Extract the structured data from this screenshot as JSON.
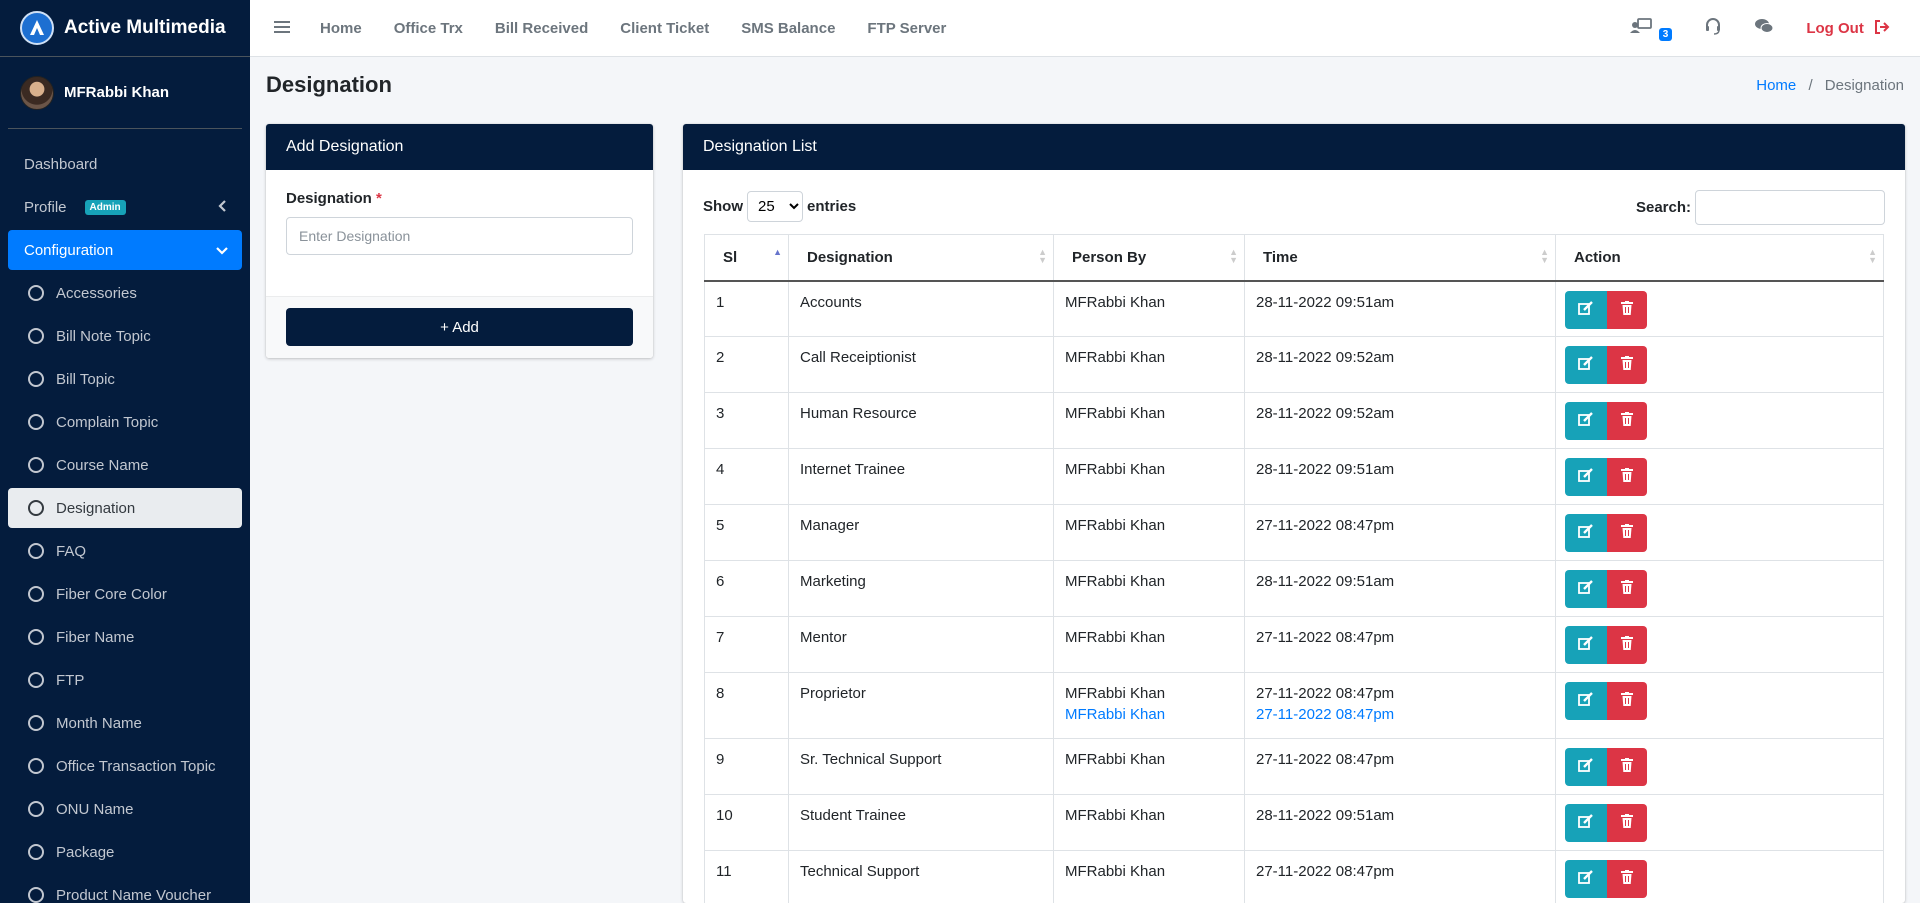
{
  "brand": {
    "name": "Active Multimedia"
  },
  "user": {
    "name": "MFRabbi Khan"
  },
  "sidebar": {
    "dashboard": "Dashboard",
    "profile": "Profile",
    "profile_badge": "Admin",
    "configuration": "Configuration",
    "items": [
      "Accessories",
      "Bill Note Topic",
      "Bill Topic",
      "Complain Topic",
      "Course Name",
      "Designation",
      "FAQ",
      "Fiber Core Color",
      "Fiber Name",
      "FTP",
      "Month Name",
      "Office Transaction Topic",
      "ONU Name",
      "Package",
      "Product Name Voucher"
    ],
    "selected": "Designation"
  },
  "topnav": {
    "links": [
      "Home",
      "Office Trx",
      "Bill Received",
      "Client Ticket",
      "SMS Balance",
      "FTP Server"
    ],
    "notification_count": "3",
    "logout": "Log Out"
  },
  "page": {
    "title": "Designation",
    "breadcrumb_home": "Home",
    "breadcrumb_sep": "/",
    "breadcrumb_current": "Designation"
  },
  "add_card": {
    "title": "Add Designation",
    "field_label": "Designation",
    "required_mark": "*",
    "placeholder": "Enter Designation",
    "button": "+ Add"
  },
  "list_card": {
    "title": "Designation List",
    "show_label": "Show",
    "entries_value": "25",
    "entries_label": "entries",
    "search_label": "Search:",
    "columns": [
      "Sl",
      "Designation",
      "Person By",
      "Time",
      "Action"
    ],
    "rows": [
      {
        "sl": "1",
        "designation": "Accounts",
        "person": "MFRabbi Khan",
        "time": "28-11-2022 09:51am"
      },
      {
        "sl": "2",
        "designation": "Call Receiptionist",
        "person": "MFRabbi Khan",
        "time": "28-11-2022 09:52am"
      },
      {
        "sl": "3",
        "designation": "Human Resource",
        "person": "MFRabbi Khan",
        "time": "28-11-2022 09:52am"
      },
      {
        "sl": "4",
        "designation": "Internet Trainee",
        "person": "MFRabbi Khan",
        "time": "28-11-2022 09:51am"
      },
      {
        "sl": "5",
        "designation": "Manager",
        "person": "MFRabbi Khan",
        "time": "27-11-2022 08:47pm"
      },
      {
        "sl": "6",
        "designation": "Marketing",
        "person": "MFRabbi Khan",
        "time": "28-11-2022 09:51am"
      },
      {
        "sl": "7",
        "designation": "Mentor",
        "person": "MFRabbi Khan",
        "time": "27-11-2022 08:47pm"
      },
      {
        "sl": "8",
        "designation": "Proprietor",
        "person": "MFRabbi Khan",
        "time": "27-11-2022 08:47pm",
        "person2": "MFRabbi Khan",
        "time2": "27-11-2022 08:47pm"
      },
      {
        "sl": "9",
        "designation": "Sr. Technical Support",
        "person": "MFRabbi Khan",
        "time": "27-11-2022 08:47pm"
      },
      {
        "sl": "10",
        "designation": "Student Trainee",
        "person": "MFRabbi Khan",
        "time": "28-11-2022 09:51am"
      },
      {
        "sl": "11",
        "designation": "Technical Support",
        "person": "MFRabbi Khan",
        "time": "27-11-2022 08:47pm"
      }
    ]
  },
  "colors": {
    "navy": "#041c3d",
    "primary": "#007bff",
    "info": "#17a2b8",
    "danger": "#dc3545"
  },
  "icons": {
    "menu": "hamburger-icon",
    "notify": "notification-icon",
    "support": "headset-icon",
    "chat": "chat-icon",
    "logout": "logout-icon",
    "edit": "edit-icon",
    "delete": "trash-icon"
  }
}
